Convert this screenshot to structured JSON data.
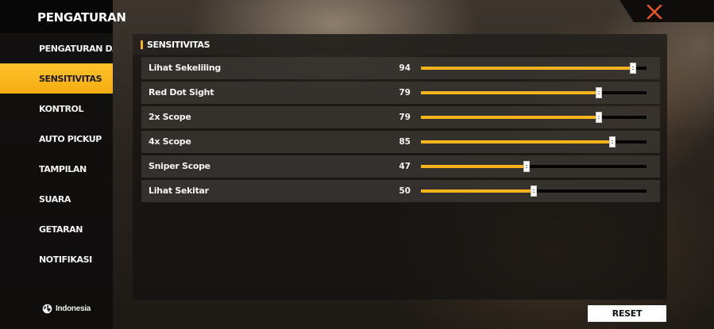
{
  "sidebar": {
    "title": "PENGATURAN",
    "items": [
      {
        "label": "PENGATURAN DASAR",
        "active": false
      },
      {
        "label": "SENSITIVITAS",
        "active": true
      },
      {
        "label": "KONTROL",
        "active": false
      },
      {
        "label": "AUTO PICKUP",
        "active": false
      },
      {
        "label": "TAMPILAN",
        "active": false
      },
      {
        "label": "SUARA",
        "active": false
      },
      {
        "label": "GETARAN",
        "active": false
      },
      {
        "label": "NOTIFIKASI",
        "active": false
      }
    ],
    "language": {
      "label": "Indonesia",
      "icon": "globe-icon"
    }
  },
  "close": {
    "icon": "close-icon",
    "color": "#e8572a"
  },
  "panel": {
    "title": "SENSITIVITAS",
    "accent": "#f6b31c",
    "sliders": [
      {
        "label": "Lihat Sekeliling",
        "value": "94",
        "level": 94,
        "max": 100
      },
      {
        "label": "Red Dot Sight",
        "value": "79",
        "level": 79,
        "max": 100
      },
      {
        "label": "2x Scope",
        "value": "79",
        "level": 79,
        "max": 100
      },
      {
        "label": "4x Scope",
        "value": "85",
        "level": 85,
        "max": 100
      },
      {
        "label": "Sniper Scope",
        "value": "47",
        "level": 47,
        "max": 100
      },
      {
        "label": "Lihat Sekitar",
        "value": "50",
        "level": 50,
        "max": 100
      }
    ]
  },
  "reset_label": "RESET"
}
